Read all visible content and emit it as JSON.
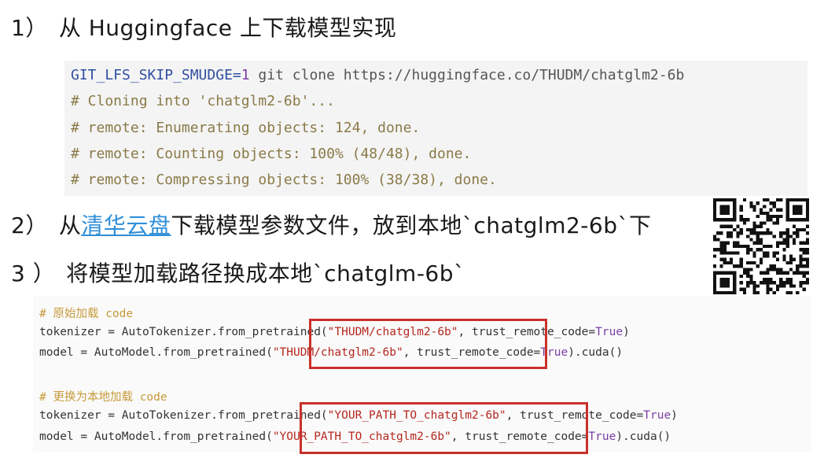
{
  "steps": [
    {
      "num": "1）",
      "text": "从 Huggingface 上下载模型实现"
    },
    {
      "num": "2）",
      "prefix": "从",
      "link": "清华云盘",
      "suffix": "下载模型参数文件，放到本地`chatglm2-6b`下"
    },
    {
      "num": "3 ）",
      "text": "将模型加载路径换成本地`chatglm-6b`"
    }
  ],
  "git_block": {
    "line1": {
      "var": "GIT_LFS_SKIP_SMUDGE",
      "eq": "=",
      "val": "1",
      "cmd": " git clone https://huggingface.co/THUDM/chatglm2-6b"
    },
    "comments": [
      "# Cloning into 'chatglm2-6b'...",
      "# remote: Enumerating objects: 124, done.",
      "# remote: Counting objects: 100% (48/48), done.",
      "# remote: Compressing objects: 100% (38/38), done."
    ]
  },
  "load_block": {
    "comment_original": "# 原始加载 code",
    "comment_replace": "# 更换为本地加载 code",
    "tok_prefix": "tokenizer = AutoTokenizer.from_pretrained(",
    "model_prefix": "model = AutoModel.from_pretrained(",
    "orig_path": "\"THUDM/chatglm2-6b\"",
    "local_path": "\"YOUR_PATH_TO_chatglm2-6b\"",
    "trust_arg": ", trust_remote_code=",
    "true_kw": "True",
    "tok_suffix": ")",
    "model_suffix": ").cuda()"
  },
  "colors": {
    "highlight_box": "#c8312a",
    "link": "#2f8fd8"
  },
  "qr_code": "qr-code-image"
}
